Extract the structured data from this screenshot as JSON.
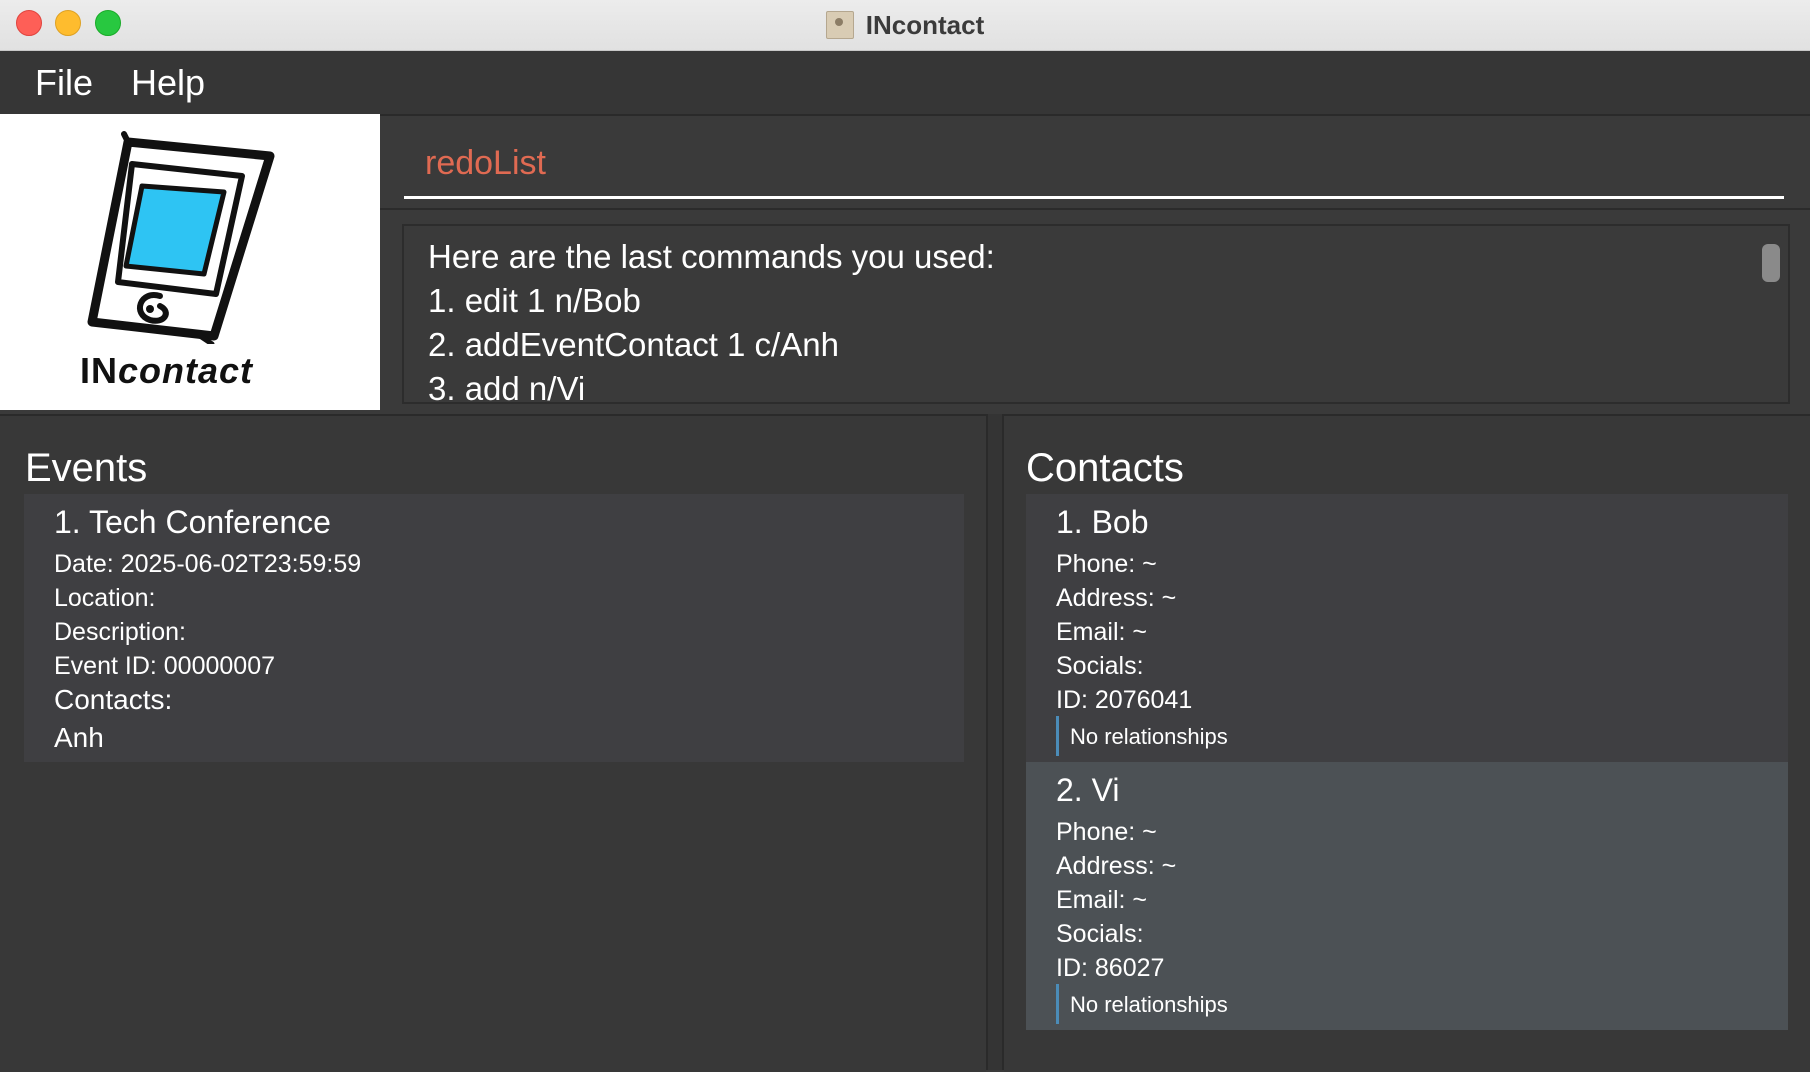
{
  "window": {
    "title": "INcontact"
  },
  "menu": {
    "file": "File",
    "help": "Help"
  },
  "logo": {
    "text_prefix": "IN",
    "text_suffix": "contact"
  },
  "command": {
    "value": "redoList"
  },
  "result": {
    "lines": [
      "Here are the last commands you used:",
      "1. edit 1 n/Bob",
      "2. addEventContact 1 c/Anh",
      "3. add n/Vi"
    ]
  },
  "events": {
    "title": "Events",
    "items": [
      {
        "heading": "1.  Tech Conference",
        "date": "Date: 2025-06-02T23:59:59",
        "location": "Location:",
        "description": "Description:",
        "event_id": "Event ID: 00000007",
        "contacts_label": "Contacts:",
        "contacts": "Anh"
      }
    ]
  },
  "contacts": {
    "title": "Contacts",
    "items": [
      {
        "heading": "1. Bob",
        "phone": "Phone: ~",
        "address": "Address: ~",
        "email": "Email: ~",
        "socials": "Socials:",
        "id": "ID: 2076041",
        "relationships": "No relationships"
      },
      {
        "heading": "2. Vi",
        "phone": "Phone: ~",
        "address": "Address: ~",
        "email": "Email: ~",
        "socials": "Socials:",
        "id": "ID: 86027",
        "relationships": "No relationships"
      }
    ]
  },
  "colors": {
    "accent_command": "#e06a52",
    "background": "#3a3a3a",
    "card": "#3f3f42",
    "card_selected": "#4c5155",
    "relationship_bar": "#4b8cb8",
    "logo_screen": "#2ec4f3"
  }
}
